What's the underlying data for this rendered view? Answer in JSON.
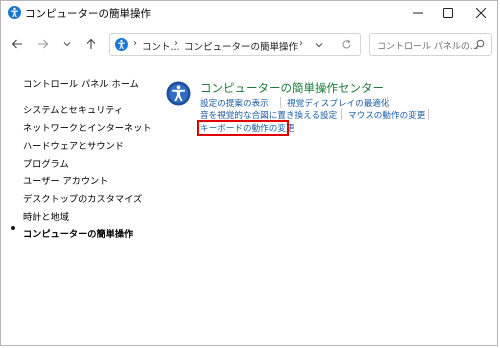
{
  "window": {
    "title": "コンピューターの簡単操作",
    "minimize_icon": "minimize-icon",
    "maximize_icon": "maximize-icon",
    "close_icon": "close-icon"
  },
  "nav": {
    "back_icon": "arrow-left-icon",
    "forward_icon": "arrow-right-icon",
    "recent_icon": "chevron-down-icon",
    "up_icon": "arrow-up-icon",
    "breadcrumb": [
      "コント...",
      "コンピューターの簡単操作"
    ],
    "search_placeholder": "コントロール パネルの..."
  },
  "sidebar": {
    "home": "コントロール パネル ホーム",
    "items": [
      "システムとセキュリティ",
      "ネットワークとインターネット",
      "ハードウェアとサウンド",
      "プログラム",
      "ユーザー アカウント",
      "デスクトップのカスタマイズ",
      "時計と地域",
      "コンピューターの簡単操作"
    ],
    "current_index": 7
  },
  "main": {
    "category_title": "コンピューターの簡単操作センター",
    "tasks": [
      "設定の提案の表示",
      "視覚ディスプレイの最適化",
      "音を視覚的な合図に置き換える設定",
      "マウスの動作の変更",
      "キーボードの動作の変更"
    ],
    "highlight_color": "#e00000",
    "link_color": "#1a5da8",
    "title_color": "#1e7a3a"
  }
}
